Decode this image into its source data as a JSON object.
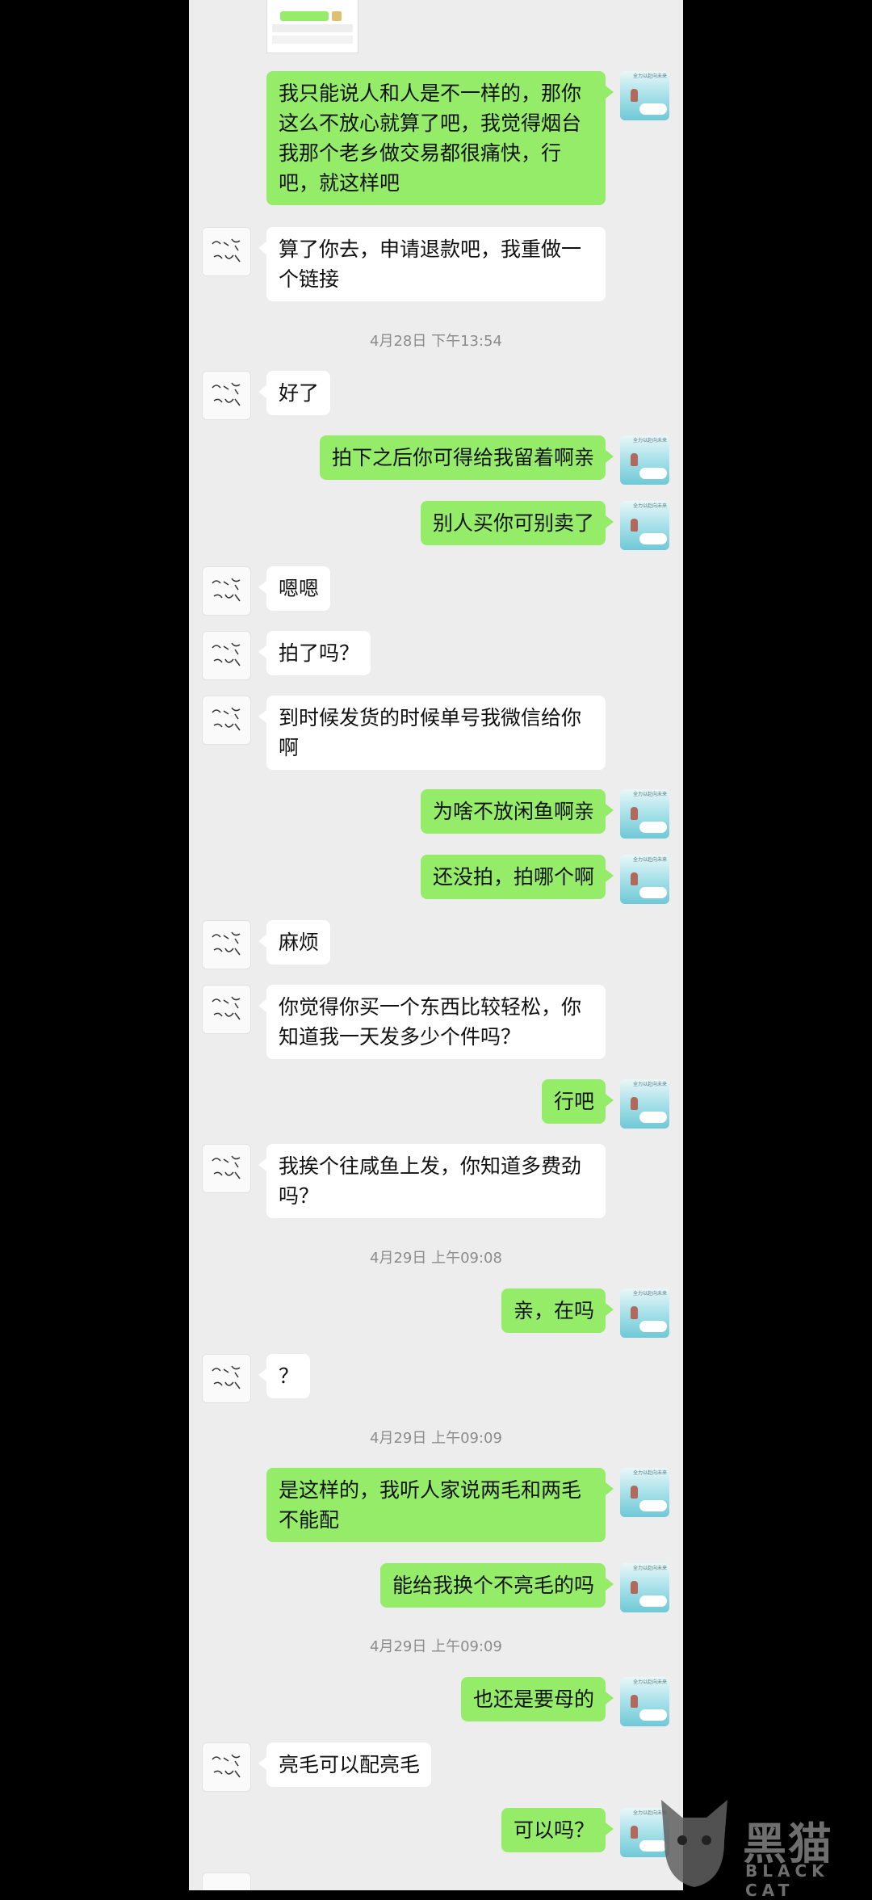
{
  "chat": {
    "messages": [
      {
        "from": "me",
        "text": "我只能说人和人是不一样的，那你这么不放心就算了吧，我觉得烟台我那个老乡做交易都很痛快，行吧，就这样吧"
      },
      {
        "from": "them",
        "text": "算了你去，申请退款吧，我重做一个链接"
      },
      {
        "timestamp": "4月28日 下午13:54"
      },
      {
        "from": "them",
        "text": "好了"
      },
      {
        "from": "me",
        "text": "拍下之后你可得给我留着啊亲"
      },
      {
        "from": "me",
        "text": "别人买你可别卖了"
      },
      {
        "from": "them",
        "text": "嗯嗯"
      },
      {
        "from": "them",
        "text": "拍了吗？"
      },
      {
        "from": "them",
        "text": "到时候发货的时候单号我微信给你啊"
      },
      {
        "from": "me",
        "text": "为啥不放闲鱼啊亲"
      },
      {
        "from": "me",
        "text": "还没拍，拍哪个啊"
      },
      {
        "from": "them",
        "text": "麻烦"
      },
      {
        "from": "them",
        "text": "你觉得你买一个东西比较轻松，你知道我一天发多少个件吗？"
      },
      {
        "from": "me",
        "text": "行吧"
      },
      {
        "from": "them",
        "text": "我挨个往咸鱼上发，你知道多费劲吗？"
      },
      {
        "timestamp": "4月29日 上午09:08"
      },
      {
        "from": "me",
        "text": "亲，在吗"
      },
      {
        "from": "them",
        "text": "？"
      },
      {
        "timestamp": "4月29日 上午09:09"
      },
      {
        "from": "me",
        "text": "是这样的，我听人家说两毛和两毛不能配"
      },
      {
        "from": "me",
        "text": "能给我换个不亮毛的吗"
      },
      {
        "timestamp": "4月29日 上午09:09"
      },
      {
        "from": "me",
        "text": "也还是要母的"
      },
      {
        "from": "them",
        "text": "亮毛可以配亮毛"
      },
      {
        "from": "me",
        "text": "可以吗？"
      }
    ]
  },
  "avatar_caption": "全力以赴向未来",
  "watermark": {
    "title": "黑猫",
    "subtitle": "BLACK CAT"
  },
  "colors": {
    "my_bubble": "#95ec69",
    "their_bubble": "#ffffff",
    "chat_bg": "#ededed",
    "timestamp": "#8c8c8c"
  },
  "icons": [
    "user-avatar-icon",
    "contact-avatar-icon",
    "black-cat-logo-icon"
  ]
}
